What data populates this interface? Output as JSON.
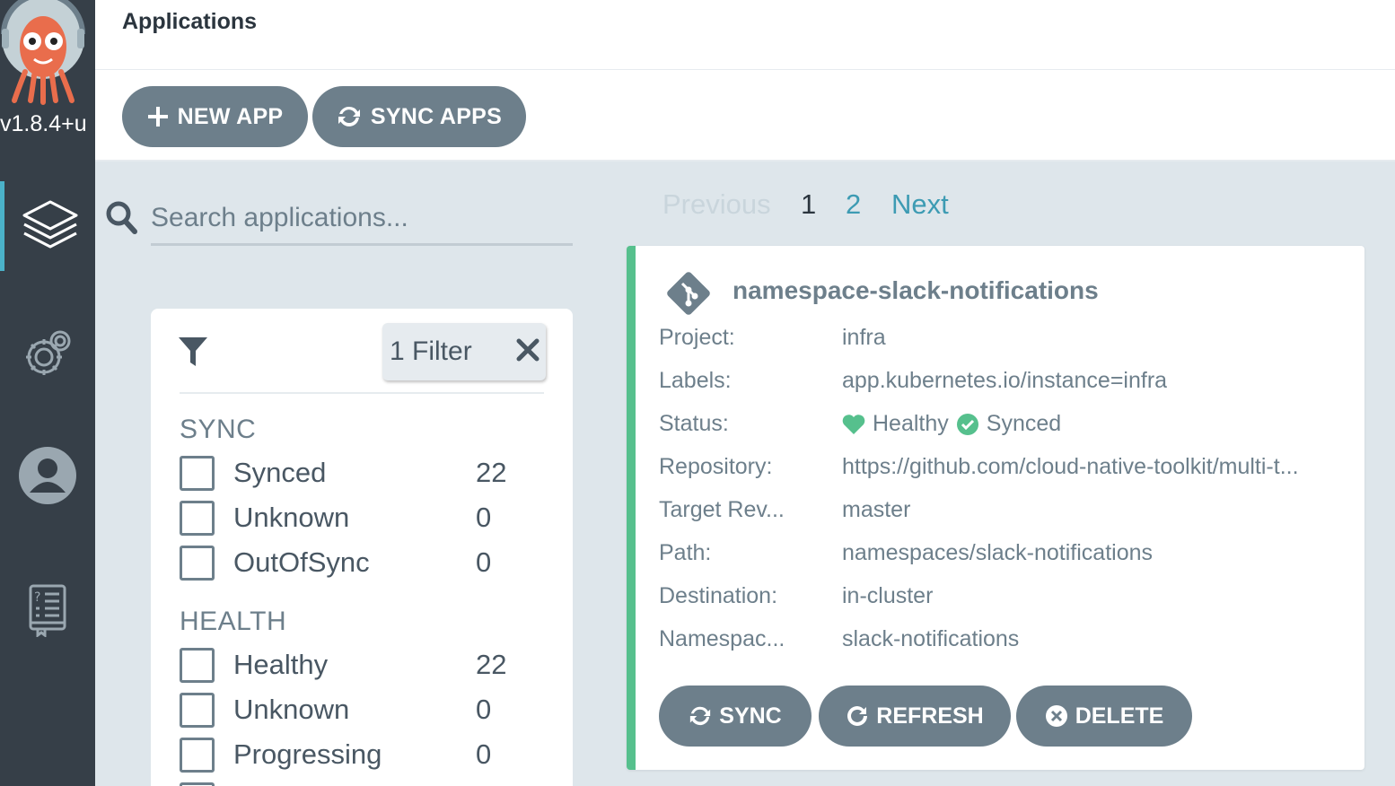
{
  "sidebar": {
    "version": "v1.8.4+u",
    "nav": [
      {
        "icon": "layers-icon",
        "label": "Applications"
      },
      {
        "icon": "gear-icon",
        "label": "Settings"
      },
      {
        "icon": "user-icon",
        "label": "User Info"
      },
      {
        "icon": "docs-icon",
        "label": "Documentation"
      }
    ]
  },
  "header": {
    "title": "Applications"
  },
  "toolbar": {
    "new_app": "NEW APP",
    "sync_apps": "SYNC APPS"
  },
  "search": {
    "placeholder": "Search applications..."
  },
  "filters": {
    "chip": "1 Filter",
    "sync": {
      "title": "SYNC",
      "items": [
        {
          "label": "Synced",
          "count": "22"
        },
        {
          "label": "Unknown",
          "count": "0"
        },
        {
          "label": "OutOfSync",
          "count": "0"
        }
      ]
    },
    "health": {
      "title": "HEALTH",
      "items": [
        {
          "label": "Healthy",
          "count": "22"
        },
        {
          "label": "Unknown",
          "count": "0"
        },
        {
          "label": "Progressing",
          "count": "0"
        }
      ]
    }
  },
  "pagination": {
    "previous": "Previous",
    "page1": "1",
    "page2": "2",
    "next": "Next"
  },
  "app": {
    "name": "namespace-slack-notifications",
    "fields": {
      "project_label": "Project:",
      "project": "infra",
      "labels_label": "Labels:",
      "labels": "app.kubernetes.io/instance=infra",
      "status_label": "Status:",
      "health": "Healthy",
      "sync": "Synced",
      "repo_label": "Repository:",
      "repo": "https://github.com/cloud-native-toolkit/multi-t...",
      "rev_label": "Target Rev...",
      "rev": "master",
      "path_label": "Path:",
      "path": "namespaces/slack-notifications",
      "dest_label": "Destination:",
      "dest": "in-cluster",
      "ns_label": "Namespac...",
      "ns": "slack-notifications"
    },
    "actions": {
      "sync": "SYNC",
      "refresh": "REFRESH",
      "delete": "DELETE"
    }
  },
  "colors": {
    "sidebar": "#363f48",
    "accent": "#4bb2c9",
    "healthy": "#56c08d",
    "button": "#6d7f8b"
  }
}
